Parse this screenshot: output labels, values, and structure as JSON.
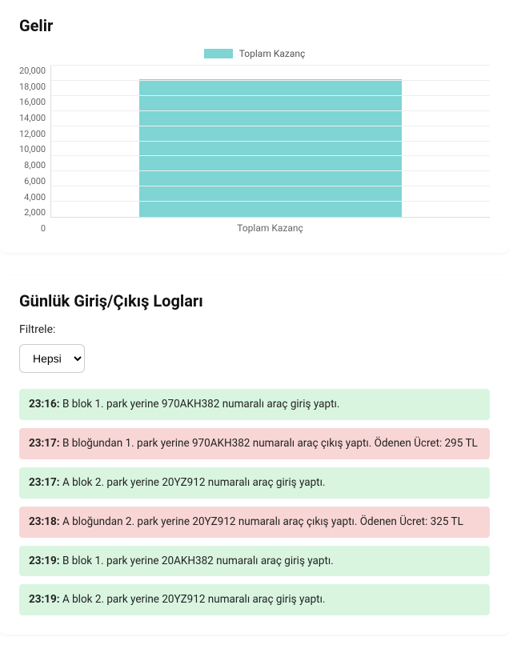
{
  "income": {
    "title": "Gelir",
    "legend": "Toplam Kazanç",
    "x_category_label": "Toplam Kazanç"
  },
  "chart_data": {
    "type": "bar",
    "categories": [
      "Toplam Kazanç"
    ],
    "series": [
      {
        "name": "Toplam Kazanç",
        "values": [
          18200
        ]
      }
    ],
    "title": "Gelir",
    "xlabel": "",
    "ylabel": "",
    "ylim": [
      0,
      20000
    ],
    "y_ticks": [
      20000,
      18000,
      16000,
      14000,
      12000,
      10000,
      8000,
      6000,
      4000,
      2000,
      0
    ],
    "y_tick_labels": [
      "20,000",
      "18,000",
      "16,000",
      "14,000",
      "12,000",
      "10,000",
      "8,000",
      "6,000",
      "4,000",
      "2,000",
      "0"
    ],
    "legend_position": "top",
    "grid": true,
    "bar_color": "#7fd4d4"
  },
  "logs": {
    "title": "Günlük Giriş/Çıkış Logları",
    "filter_label": "Filtrele:",
    "filter_selected": "Hepsi",
    "entries": [
      {
        "time": "23:16",
        "kind": "in",
        "text": "B blok 1. park yerine 970AKH382 numaralı araç giriş yaptı."
      },
      {
        "time": "23:17",
        "kind": "out",
        "text": "B bloğundan 1. park yerine 970AKH382 numaralı araç çıkış yaptı. Ödenen Ücret: 295 TL"
      },
      {
        "time": "23:17",
        "kind": "in",
        "text": "A blok 2. park yerine 20YZ912 numaralı araç giriş yaptı."
      },
      {
        "time": "23:18",
        "kind": "out",
        "text": "A bloğundan 2. park yerine 20YZ912 numaralı araç çıkış yaptı. Ödenen Ücret: 325 TL"
      },
      {
        "time": "23:19",
        "kind": "in",
        "text": "B blok 1. park yerine 20AKH382 numaralı araç giriş yaptı."
      },
      {
        "time": "23:19",
        "kind": "in",
        "text": "A blok 2. park yerine 20YZ912 numaralı araç giriş yaptı."
      }
    ]
  }
}
